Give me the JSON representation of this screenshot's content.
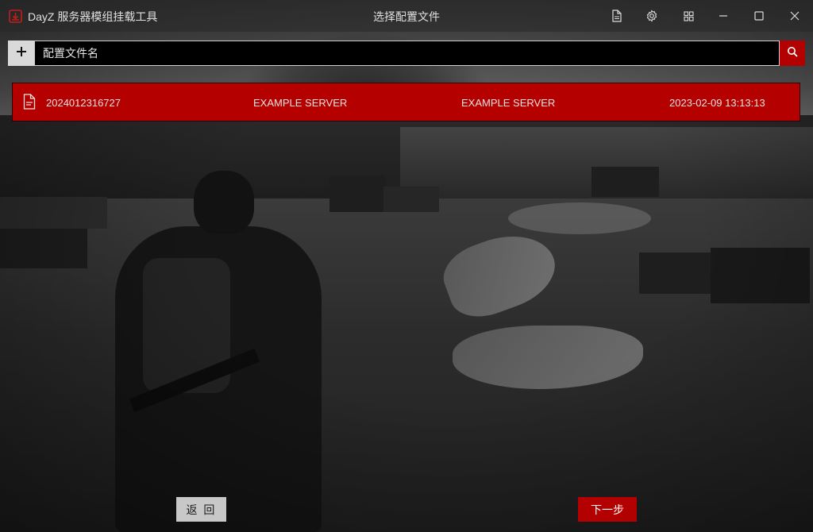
{
  "app": {
    "title": "DayZ 服务器模组挂载工具",
    "window_title": "选择配置文件"
  },
  "titlebar_buttons": {
    "file_icon": "file-icon",
    "settings_icon": "gear-icon",
    "grid_icon": "grid-icon",
    "minimize_icon": "minimize-icon",
    "maximize_icon": "maximize-icon",
    "close_icon": "close-icon"
  },
  "search": {
    "add_icon": "plus-icon",
    "placeholder": "配置文件名",
    "value": "",
    "search_icon": "search-icon"
  },
  "configs": [
    {
      "id": "2024012316727",
      "name": "EXAMPLE SERVER",
      "server": "EXAMPLE SERVER",
      "date": "2023-02-09 13:13:13"
    }
  ],
  "buttons": {
    "back": "返 回",
    "next": "下一步"
  },
  "colors": {
    "accent": "#b30000",
    "row_bg": "#b50000",
    "back_button_bg": "#c8c8c8"
  }
}
